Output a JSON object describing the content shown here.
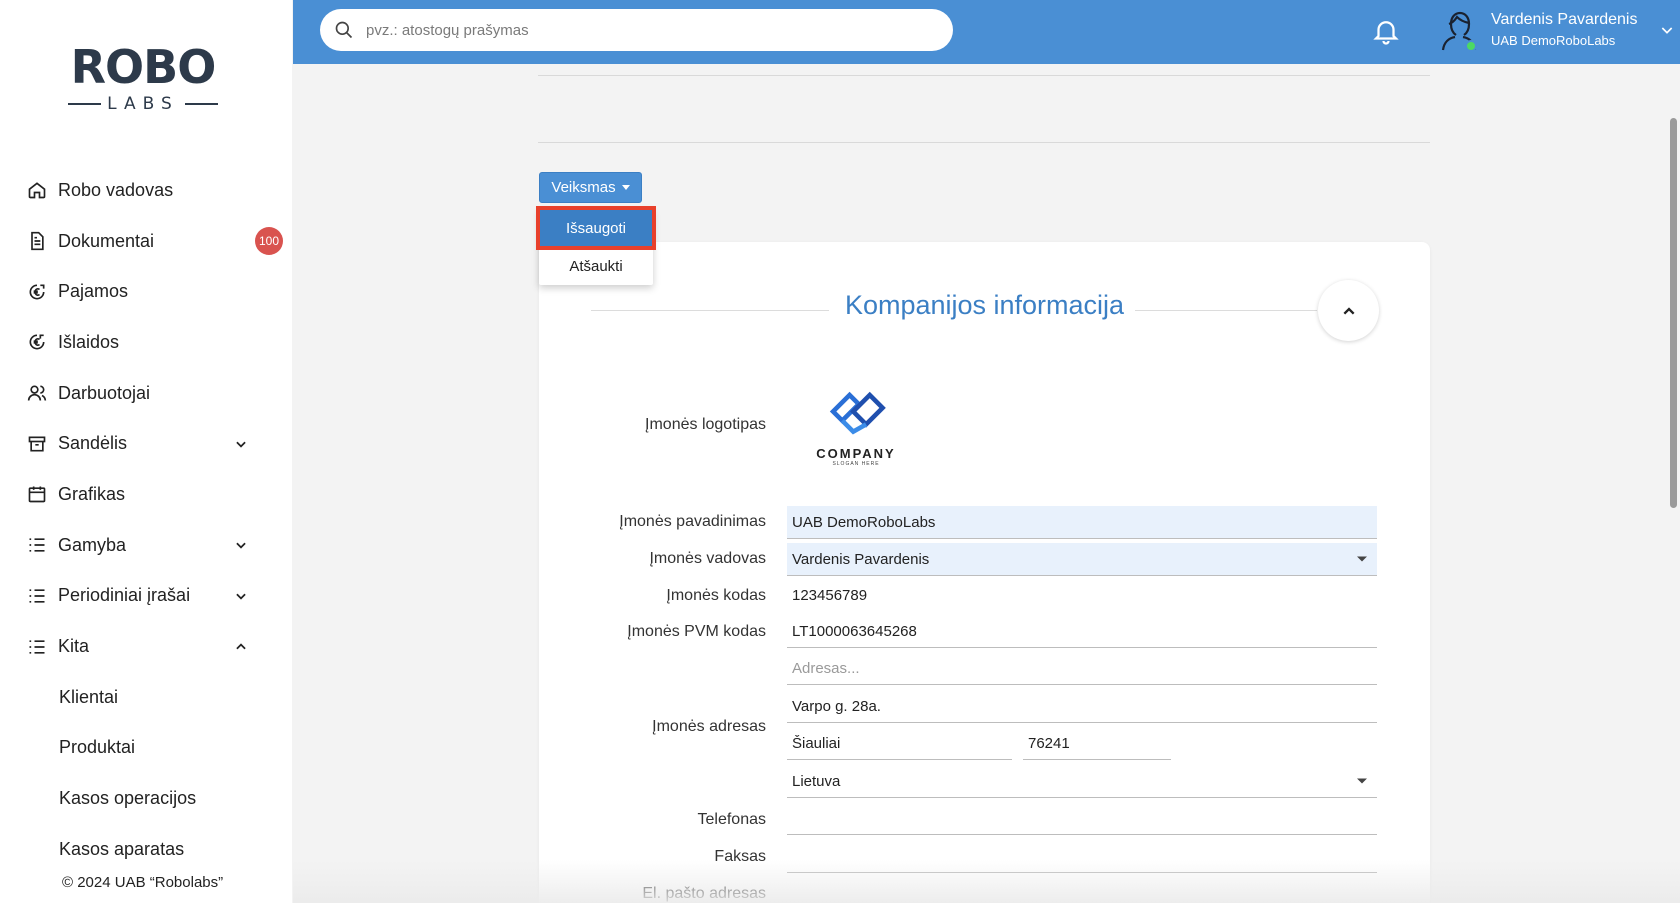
{
  "brand": {
    "logo_top": "ROBO",
    "logo_bottom": "LABS"
  },
  "sidebar": {
    "items": [
      {
        "label": "Robo vadovas",
        "icon": "home-icon"
      },
      {
        "label": "Dokumentai",
        "icon": "document-icon",
        "badge": "100"
      },
      {
        "label": "Pajamos",
        "icon": "euro-in-icon"
      },
      {
        "label": "Išlaidos",
        "icon": "euro-out-icon"
      },
      {
        "label": "Darbuotojai",
        "icon": "users-icon"
      },
      {
        "label": "Sandėlis",
        "icon": "archive-icon",
        "expandable": true
      },
      {
        "label": "Grafikas",
        "icon": "calendar-icon"
      },
      {
        "label": "Gamyba",
        "icon": "list-icon",
        "expandable": true
      },
      {
        "label": "Periodiniai įrašai",
        "icon": "list-icon",
        "expandable": true
      },
      {
        "label": "Kita",
        "icon": "list-icon",
        "expanded": true
      }
    ],
    "sub_items": [
      "Klientai",
      "Produktai",
      "Kasos operacijos",
      "Kasos aparatas"
    ],
    "copyright": "© 2024 UAB “Robolabs”"
  },
  "header": {
    "search_placeholder": "pvz.: atostogų prašymas",
    "user_name": "Vardenis Pavardenis",
    "user_company": "UAB DemoRoboLabs"
  },
  "actions": {
    "button_label": "Veiksmas",
    "menu": [
      "Išsaugoti",
      "Atšaukti"
    ],
    "active_item": "Išsaugoti"
  },
  "card": {
    "title": "Kompanijos informacija",
    "logo_label": "Įmonės logotipas",
    "logo_text": "COMPANY",
    "logo_slogan": "SLOGAN HERE",
    "fields": {
      "name_label": "Įmonės pavadinimas",
      "name_value": "UAB DemoRoboLabs",
      "manager_label": "Įmonės vadovas",
      "manager_value": "Vardenis Pavardenis",
      "code_label": "Įmonės kodas",
      "code_value": "123456789",
      "vat_label": "Įmonės PVM kodas",
      "vat_value": "LT1000063645268",
      "address_label": "Įmonės adresas",
      "address_placeholder": "Adresas...",
      "street_value": "Varpo g. 28a.",
      "city_value": "Šiauliai",
      "zip_value": "76241",
      "country_value": "Lietuva",
      "phone_label": "Telefonas",
      "fax_label": "Faksas",
      "email_label": "El. pašto adresas"
    }
  },
  "colors": {
    "accent": "#4a8fd4",
    "title": "#3b7fc4",
    "badge": "#d9534f",
    "highlight_border": "#e8402b"
  }
}
